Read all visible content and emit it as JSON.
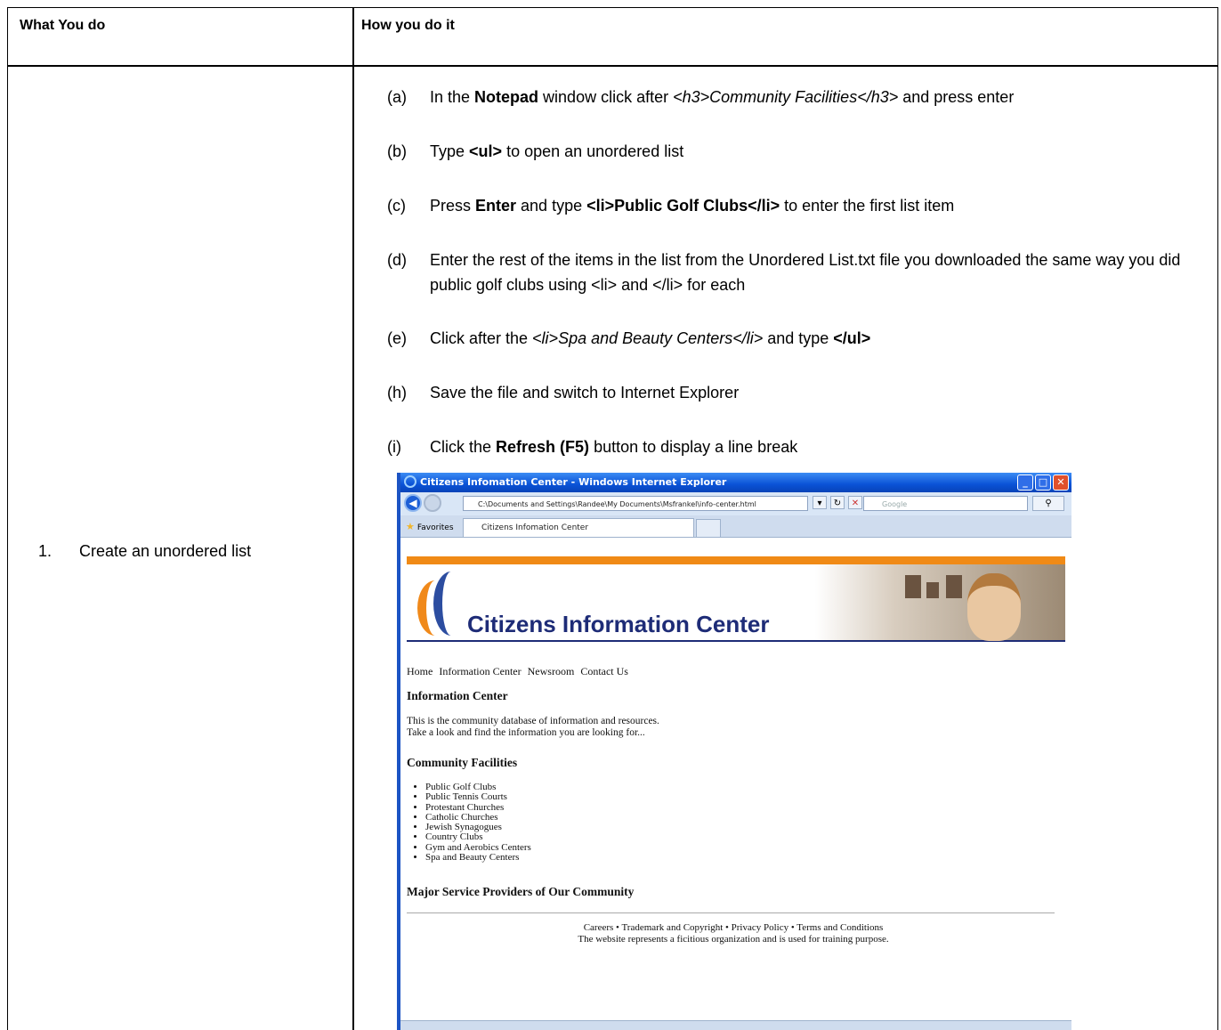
{
  "table": {
    "header_left": "What You do",
    "header_right": "How you do it",
    "task_number": "1.",
    "task_label": "Create an unordered list"
  },
  "steps": [
    {
      "label": "(a)",
      "parts": [
        "In the ",
        "Notepad",
        " window click after ",
        "<h3>Community Facilities</h3>",
        " and press enter"
      ]
    },
    {
      "label": "(b)",
      "parts": [
        "Type ",
        "<ul>",
        " to open an unordered list"
      ]
    },
    {
      "label": "(c)",
      "parts": [
        "Press ",
        "Enter",
        " and type ",
        "<li>Public Golf Clubs</li>",
        " to enter the first list item"
      ]
    },
    {
      "label": "(d)",
      "text": "Enter the rest of the items in the list from the Unordered List.txt file you downloaded the same way you did public golf clubs using <li> and </li> for each"
    },
    {
      "label": "(e)",
      "parts": [
        "Click after the ",
        "<li>Spa and Beauty Centers</li>",
        " and type ",
        "</ul>"
      ]
    },
    {
      "label": "(h)",
      "text": "Save the file and switch to Internet Explorer"
    },
    {
      "label": "(i)",
      "parts": [
        "Click the ",
        "Refresh (F5)",
        " button to display a line break"
      ]
    }
  ],
  "browser": {
    "window_title": "Citizens Infomation Center - Windows Internet Explorer",
    "address": "C:\\Documents and Settings\\Randee\\My Documents\\Msfrankel\\info-center.html",
    "search_placeholder": "Google",
    "favorites_label": "Favorites",
    "tab_title": "Citizens Infomation Center",
    "page": {
      "banner_title": "Citizens Information Center",
      "nav_items": [
        "Home",
        "Information Center",
        "Newsroom",
        "Contact Us"
      ],
      "heading_info": "Information Center",
      "intro_line1": "This is the community database of information and resources.",
      "intro_line2": "Take a look and find the information you are looking for...",
      "heading_facilities": "Community Facilities",
      "facilities": [
        "Public Golf Clubs",
        "Public Tennis Courts",
        "Protestant Churches",
        "Catholic Churches",
        "Jewish Synagogues",
        "Country Clubs",
        "Gym and Aerobics Centers",
        "Spa and Beauty Centers"
      ],
      "heading_providers": "Major Service Providers of Our Community",
      "footer_line1": "Careers • Trademark and Copyright • Privacy Policy • Terms and Conditions",
      "footer_line2": "The website represents a ficitious organization and is used for training purpose."
    }
  }
}
